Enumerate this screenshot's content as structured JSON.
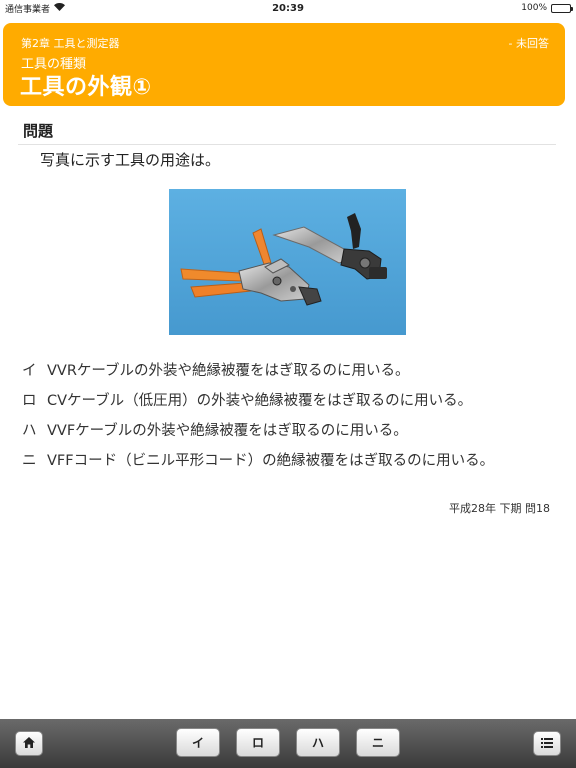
{
  "status_bar": {
    "carrier": "通信事業者",
    "time": "20:39",
    "battery": "100%"
  },
  "header": {
    "chapter": "第2章 工具と測定器",
    "status": "- 未回答",
    "subtitle": "工具の種類",
    "title": "工具の外観①"
  },
  "question": {
    "section_title": "問題",
    "text": "写真に示す工具の用途は。"
  },
  "choices": [
    {
      "key": "イ",
      "text": "VVRケーブルの外装や絶縁被覆をはぎ取るのに用いる。"
    },
    {
      "key": "ロ",
      "text": "CVケーブル（低圧用）の外装や絶縁被覆をはぎ取るのに用いる。"
    },
    {
      "key": "ハ",
      "text": "VVFケーブルの外装や絶縁被覆をはぎ取るのに用いる。"
    },
    {
      "key": "ニ",
      "text": "VFFコード（ビニル平形コード）の絶縁被覆をはぎ取るのに用いる。"
    }
  ],
  "source": "平成28年 下期 問18",
  "toolbar": {
    "home_icon": "home-icon",
    "answer_buttons": [
      "イ",
      "ロ",
      "ハ",
      "ニ"
    ],
    "menu_icon": "list-icon"
  },
  "colors": {
    "header_bg": "#ffab00",
    "photo_bg": "#52a8dd"
  }
}
